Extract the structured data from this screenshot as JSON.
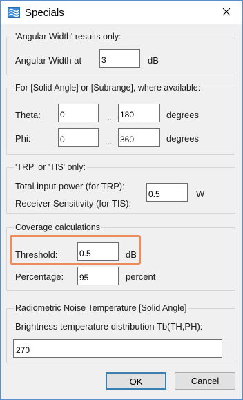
{
  "window": {
    "title": "Specials",
    "app_icon": "antenna-pattern-icon",
    "close_icon": "close-icon"
  },
  "angular": {
    "legend": "'Angular Width' results only:",
    "label": "Angular Width at",
    "value": "3",
    "unit": "dB"
  },
  "solid_angle": {
    "legend": "For [Solid Angle] or [Subrange], where available:",
    "theta": {
      "label": "Theta:",
      "from": "0",
      "sep": "...",
      "to": "180",
      "unit": "degrees"
    },
    "phi": {
      "label": "Phi:",
      "from": "0",
      "sep": "...",
      "to": "360",
      "unit": "degrees"
    }
  },
  "trp_tis": {
    "legend": "'TRP' or 'TIS' only:",
    "label1": "Total input power (for TRP):",
    "label2": "Receiver Sensitivity (for TIS):",
    "value": "0.5",
    "unit": "W"
  },
  "coverage": {
    "legend": "Coverage calculations",
    "threshold": {
      "label": "Threshold:",
      "value": "0.5",
      "unit": "dB"
    },
    "percentage": {
      "label": "Percentage:",
      "value": "95",
      "unit": "percent"
    }
  },
  "noise": {
    "legend": "Radiometric Noise Temperature [Solid Angle]",
    "label": "Brightness temperature distribution Tb(TH,PH):",
    "value": "270"
  },
  "buttons": {
    "ok": "OK",
    "cancel": "Cancel"
  }
}
